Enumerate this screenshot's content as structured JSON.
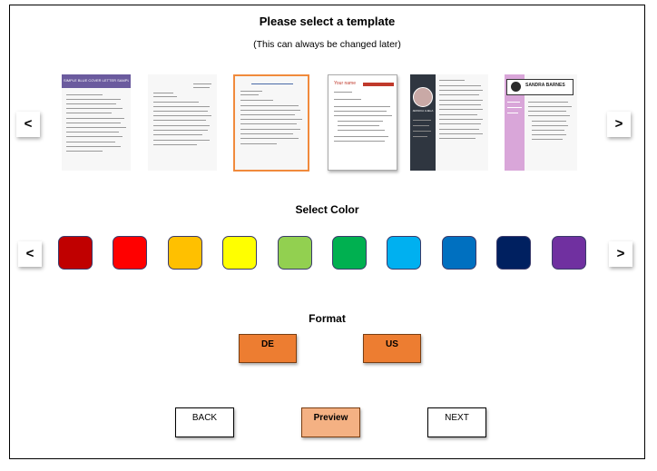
{
  "header": {
    "title": "Please select a template",
    "subtitle": "(This can always be changed later)"
  },
  "templates": {
    "prev_label": "<",
    "next_label": ">",
    "items": [
      {
        "name": "template-1",
        "heading": "SIMPLE BLUE COVER LETTER SAMPLE",
        "header_color": "#6b5b9e"
      },
      {
        "name": "template-2"
      },
      {
        "name": "template-3",
        "selected": true
      },
      {
        "name": "template-4",
        "heading": "Your name",
        "accent_color": "#c0392b"
      },
      {
        "name": "template-5",
        "name_text": "JESSICA LUELA",
        "sidebar_color": "#2f3640"
      },
      {
        "name": "template-6",
        "name_text": "SANDRA BARNES",
        "sidebar_color": "#d9a6d9"
      }
    ]
  },
  "colors": {
    "title": "Select Color",
    "prev_label": "<",
    "next_label": ">",
    "swatches": [
      "#c00000",
      "#ff0000",
      "#ffc000",
      "#ffff00",
      "#92d050",
      "#00b050",
      "#00b0f0",
      "#0070c0",
      "#002060",
      "#7030a0"
    ]
  },
  "format": {
    "title": "Format",
    "options": [
      "DE",
      "US"
    ]
  },
  "actions": {
    "back_label": "BACK",
    "preview_label": "Preview",
    "next_label": "NEXT"
  }
}
